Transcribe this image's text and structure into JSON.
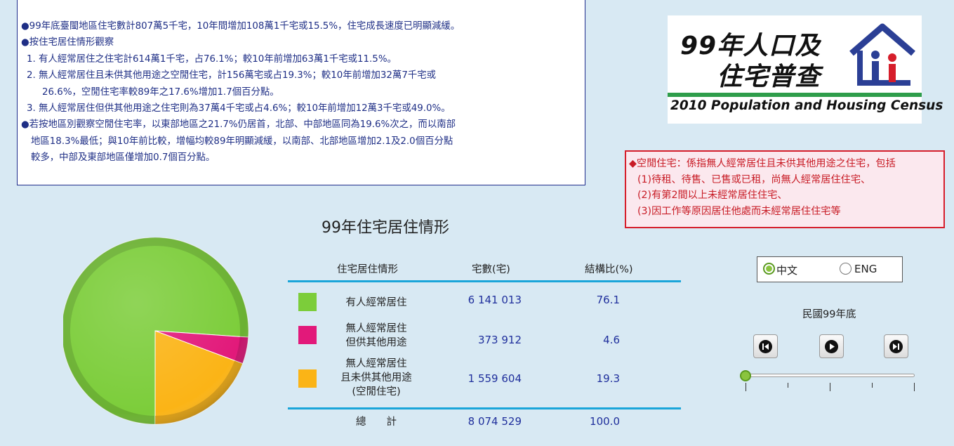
{
  "summary": {
    "lines": [
      "●99年底臺閩地區住宅數計807萬5千宅，10年間增加108萬1千宅或15.5%，住宅成長速度已明顯減緩。",
      "●按住宅居住情形觀察",
      "  1. 有人經常居住之住宅計614萬1千宅，占76.1%；較10年前增加63萬1千宅或11.5%。",
      "  2. 無人經常居住且未供其他用途之空閒住宅，計156萬宅或占19.3%；較10年前增加32萬7千宅或",
      "      26.6%，空閒住宅率較89年之17.6%增加1.7個百分點。",
      "  3. 無人經常居住但供其他用途之住宅則為37萬4千宅或占4.6%；較10年前增加12萬3千宅或49.0%。",
      "●若按地區別觀察空閒住宅率，以東部地區之21.7%仍居首，北部、中部地區同為19.6%次之，而以南部",
      "    地區18.3%最低；與10年前比較，增幅均較89年明顯減緩，以南部、北部地區增加2.1及2.0個百分點",
      "    較多，中部及東部地區僅增加0.7個百分點。"
    ]
  },
  "logo": {
    "title_line1": "99年人口及",
    "title_line2": "住宅普查",
    "english": "2010 Population and Housing Census"
  },
  "definition": {
    "lines": [
      "◆空閒住宅：係指無人經常居住且未供其他用途之住宅，包括",
      "  (1)待租、待售、已售或已租，尚無人經常居住住宅、",
      "  (2)有第2間以上未經常居住住宅、",
      "  (3)因工作等原因居住他處而未經常居住住宅等"
    ]
  },
  "chart_title": "99年住宅居住情形",
  "table": {
    "headers": [
      "住宅居住情形",
      "宅數(宅)",
      "結構比(%)"
    ],
    "rows": [
      {
        "label_lines": [
          "有人經常居住"
        ],
        "count": "6 141 013",
        "pct": "76.1",
        "color": "#7ccd3a"
      },
      {
        "label_lines": [
          "無人經常居住",
          "但供其他用途"
        ],
        "count": "373 912",
        "pct": "4.6",
        "color": "#e2197a"
      },
      {
        "label_lines": [
          "無人經常居住",
          "且未供其他用途",
          "(空閒住宅)"
        ],
        "count": "1 559 604",
        "pct": "19.3",
        "color": "#fbb416"
      }
    ],
    "total": {
      "label": "總　　計",
      "count": "8 074 529",
      "pct": "100.0"
    }
  },
  "chart_data": {
    "type": "pie",
    "categories": [
      "有人經常居住",
      "無人經常居住但供其他用途",
      "無人經常居住且未供其他用途(空閒住宅)"
    ],
    "values": [
      76.1,
      4.6,
      19.3
    ],
    "colors": [
      "#7ccd3a",
      "#e2197a",
      "#fbb416"
    ],
    "title": "99年住宅居住情形"
  },
  "language": {
    "options": [
      "中文",
      "ENG"
    ],
    "selected": "中文"
  },
  "timeline": {
    "label": "民國99年底"
  },
  "icons": {
    "first": "skip-back-icon",
    "play": "play-icon",
    "last": "skip-forward-icon"
  }
}
